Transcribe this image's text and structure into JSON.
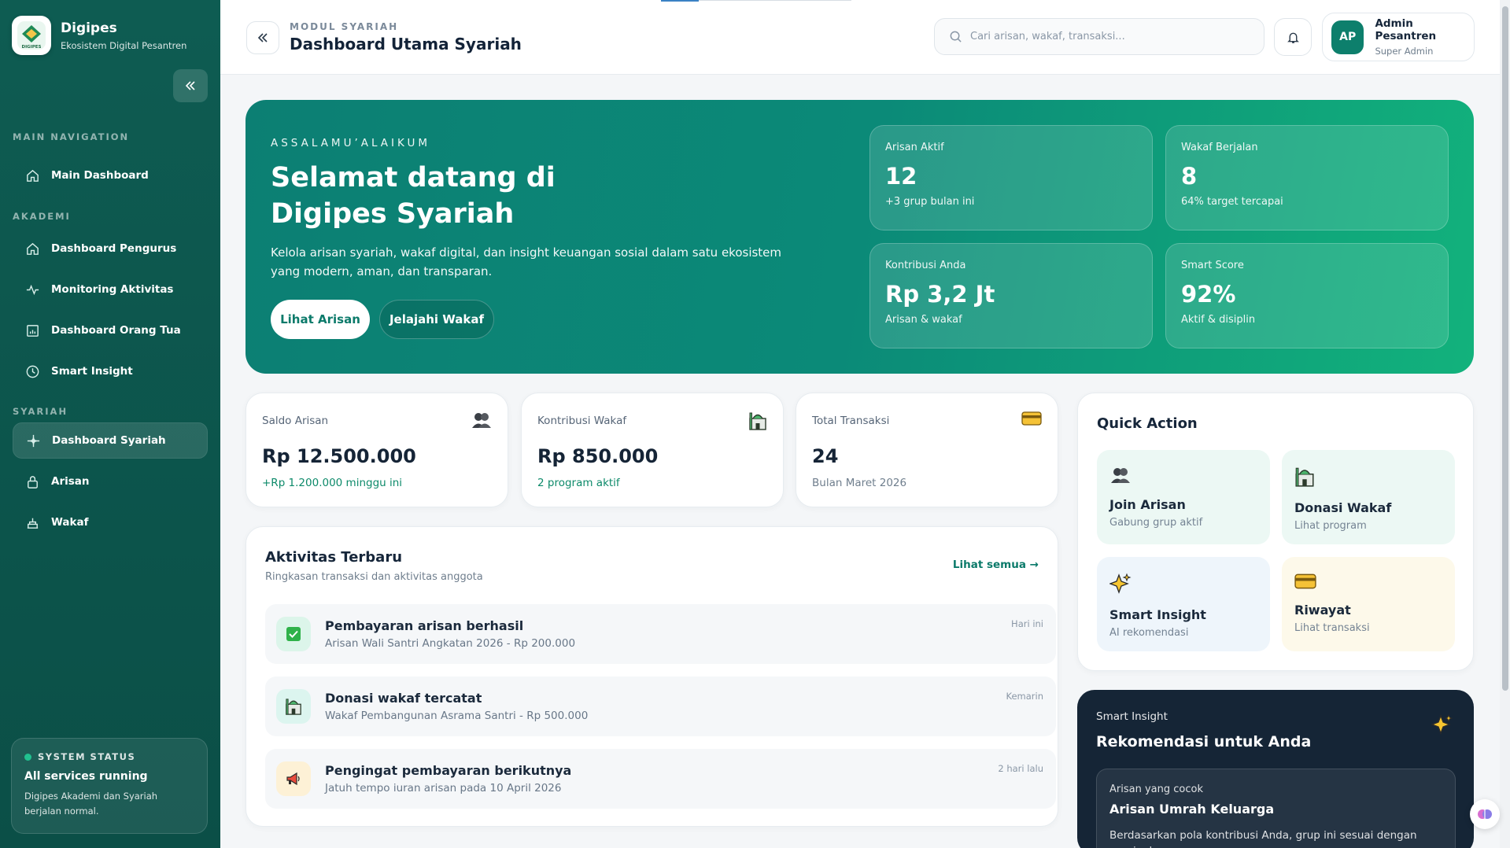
{
  "brand": {
    "name": "Digipes",
    "tagline": "Ekosistem Digital Pesantren",
    "logo_text": "DIGIPES"
  },
  "sidebar": {
    "sections": [
      "MAIN NAVIGATION",
      "AKADEMI",
      "SYARIAH"
    ],
    "items": [
      {
        "label": "Main Dashboard",
        "icon": "home-icon"
      },
      {
        "label": "Dashboard Pengurus",
        "icon": "home-icon"
      },
      {
        "label": "Monitoring Aktivitas",
        "icon": "activity-icon"
      },
      {
        "label": "Dashboard Orang Tua",
        "icon": "chart-icon"
      },
      {
        "label": "Smart Insight",
        "icon": "clock-icon"
      },
      {
        "label": "Dashboard Syariah",
        "icon": "sparkle-icon",
        "active": true
      },
      {
        "label": "Arisan",
        "icon": "lock-icon"
      },
      {
        "label": "Wakaf",
        "icon": "building-icon"
      }
    ],
    "status": {
      "label": "SYSTEM STATUS",
      "title": "All services running",
      "desc": "Digipes Akademi dan Syariah berjalan normal.",
      "color": "#22d39a"
    }
  },
  "header": {
    "module": "MODUL SYARIAH",
    "title": "Dashboard Utama Syariah",
    "search_placeholder": "Cari arisan, wakaf, transaksi..."
  },
  "profile": {
    "initials": "AP",
    "name": "Admin Pesantren",
    "role": "Super Admin"
  },
  "hero": {
    "greeting": "ASSALAMU’ALAIKUM",
    "title": "Selamat datang di Digipes Syariah",
    "desc": "Kelola arisan syariah, wakaf digital, dan insight keuangan sosial dalam satu ekosistem yang modern, aman, dan transparan.",
    "primary_button": "Lihat Arisan",
    "secondary_button": "Jelajahi Wakaf",
    "stats": [
      {
        "label": "Arisan Aktif",
        "value": "12",
        "note": "+3 grup bulan ini"
      },
      {
        "label": "Wakaf Berjalan",
        "value": "8",
        "note": "64% target tercapai"
      },
      {
        "label": "Kontribusi Anda",
        "value": "Rp 3,2 Jt",
        "note": "Arisan & wakaf"
      },
      {
        "label": "Smart Score",
        "value": "92%",
        "note": "Aktif & disiplin"
      }
    ]
  },
  "summary": [
    {
      "label": "Saldo Arisan",
      "value": "Rp 12.500.000",
      "note": "+Rp 1.200.000 minggu ini",
      "note_color": "#0d8a6a",
      "icon": "people-icon"
    },
    {
      "label": "Kontribusi Wakaf",
      "value": "Rp 850.000",
      "note": "2 program aktif",
      "note_color": "#0d8a6a",
      "icon": "mosque-icon"
    },
    {
      "label": "Total Transaksi",
      "value": "24",
      "note": "Bulan Maret 2026",
      "note_color": "#6f7e8d",
      "icon": "card-icon"
    }
  ],
  "quick_action": {
    "title": "Quick Action",
    "items": [
      {
        "name": "Join Arisan",
        "sub": "Gabung grup aktif",
        "icon": "people-icon",
        "bg": "#ecf8f4"
      },
      {
        "name": "Donasi Wakaf",
        "sub": "Lihat program",
        "icon": "mosque-icon",
        "bg": "#ecf8f4"
      },
      {
        "name": "Smart Insight",
        "sub": "AI rekomendasi",
        "icon": "sparkle-icon",
        "bg": "#eef5fb"
      },
      {
        "name": "Riwayat",
        "sub": "Lihat transaksi",
        "icon": "card-icon",
        "bg": "#fdf9ea"
      }
    ]
  },
  "activity": {
    "title": "Aktivitas Terbaru",
    "subtitle": "Ringkasan transaksi dan aktivitas anggota",
    "link": "Lihat semua →",
    "items": [
      {
        "name": "Pembayaran arisan berhasil",
        "desc": "Arisan Wali Santri Angkatan 2026 - Rp 200.000",
        "time": "Hari ini",
        "icon": "check-icon",
        "bg": "#dcf5ea"
      },
      {
        "name": "Donasi wakaf tercatat",
        "desc": "Wakaf Pembangunan Asrama Santri - Rp 500.000",
        "time": "Kemarin",
        "icon": "mosque-icon",
        "bg": "#dcf5ef"
      },
      {
        "name": "Pengingat pembayaran berikutnya",
        "desc": "Jatuh tempo iuran arisan pada 10 April 2026",
        "time": "2 hari lalu",
        "icon": "megaphone-icon",
        "bg": "#fdf1d6"
      }
    ]
  },
  "insight": {
    "label": "Smart Insight",
    "title": "Rekomendasi untuk Anda",
    "box_label": "Arisan yang cocok",
    "box_title": "Arisan Umrah Keluarga",
    "box_desc": "Berdasarkan pola kontribusi Anda, grup ini sesuai dengan nominal"
  }
}
